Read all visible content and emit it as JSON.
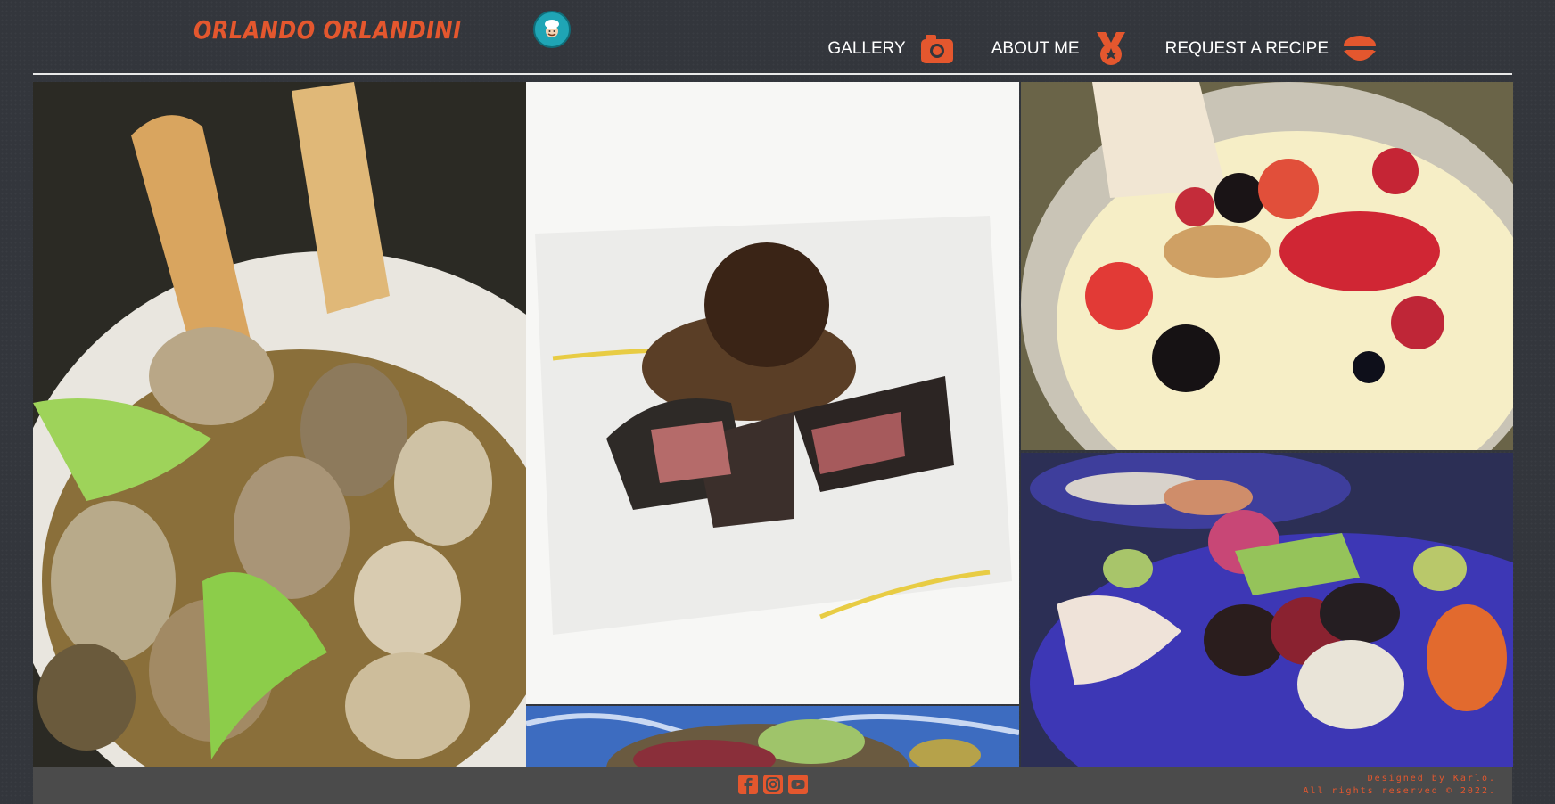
{
  "brand": {
    "name": "ORLANDO ORLANDINI",
    "logo_icon": "chef-icon"
  },
  "nav": {
    "items": [
      {
        "label": "GALLERY",
        "icon": "camera-icon"
      },
      {
        "label": "ABOUT ME",
        "icon": "medal-icon"
      },
      {
        "label": "REQUEST A RECIPE",
        "icon": "bowl-icon"
      }
    ]
  },
  "gallery": {
    "images": [
      {
        "subject": "clams-with-bread-and-celery"
      },
      {
        "subject": "steak-with-spaghetti"
      },
      {
        "subject": "berry-tart-dessert"
      },
      {
        "subject": "sushi-platter"
      },
      {
        "subject": "octopus-dish"
      }
    ]
  },
  "footer": {
    "social": [
      {
        "icon": "facebook-icon"
      },
      {
        "icon": "instagram-icon"
      },
      {
        "icon": "youtube-icon"
      }
    ],
    "credit_line1": "Designed by Karlo.",
    "credit_line2": "All rights reserved © 2022."
  },
  "colors": {
    "accent": "#e4572e",
    "background": "#33363c",
    "footer": "#4b4b4b"
  }
}
